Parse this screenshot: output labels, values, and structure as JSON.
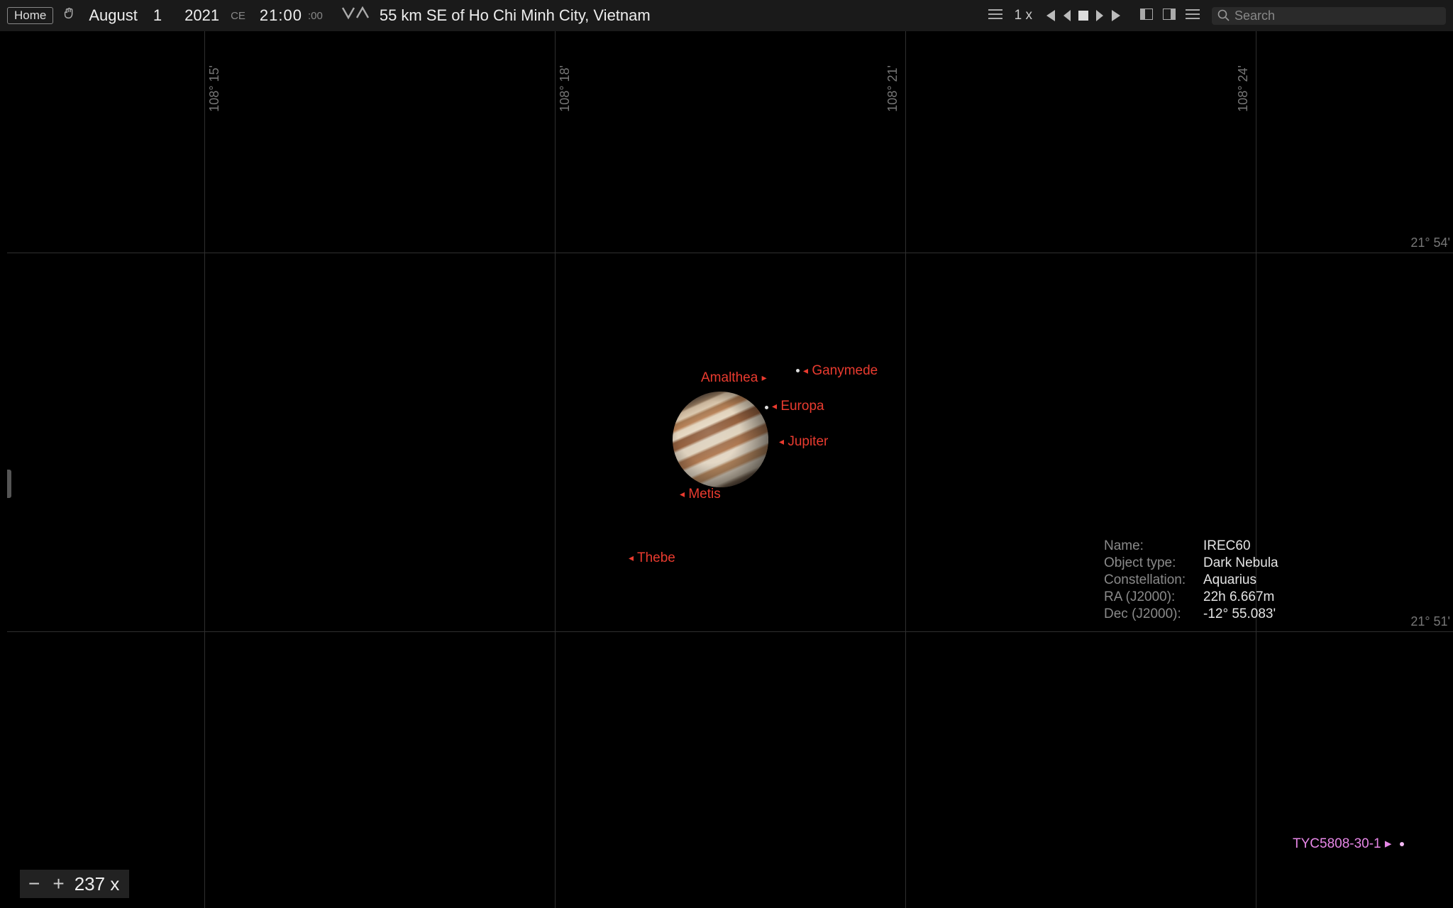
{
  "toolbar": {
    "home": "Home",
    "date_month": "August",
    "date_day": "1",
    "date_year": "2021",
    "era": "CE",
    "time_main": "21:00",
    "time_sec": ":00",
    "location": "55 km SE of Ho Chi Minh City, Vietnam",
    "speed": "1 x",
    "search_placeholder": "Search"
  },
  "grid": {
    "v_labels": [
      "108° 15'",
      "108° 18'",
      "108° 21'",
      "108° 24'"
    ],
    "h_labels": [
      "21° 54'",
      "21° 51'"
    ]
  },
  "bodies": {
    "jupiter": "Jupiter",
    "amalthea": "Amalthea",
    "ganymede": "Ganymede",
    "europa": "Europa",
    "metis": "Metis",
    "thebe": "Thebe"
  },
  "star": {
    "label": "TYC5808-30-1"
  },
  "info": {
    "k_name": "Name:",
    "v_name": "IREC60",
    "k_type": "Object type:",
    "v_type": "Dark Nebula",
    "k_const": "Constellation:",
    "v_const": "Aquarius",
    "k_ra": "RA (J2000):",
    "v_ra": "22h 6.667m",
    "k_dec": "Dec (J2000):",
    "v_dec": "-12° 55.083'"
  },
  "zoom": {
    "label": "237 x"
  }
}
